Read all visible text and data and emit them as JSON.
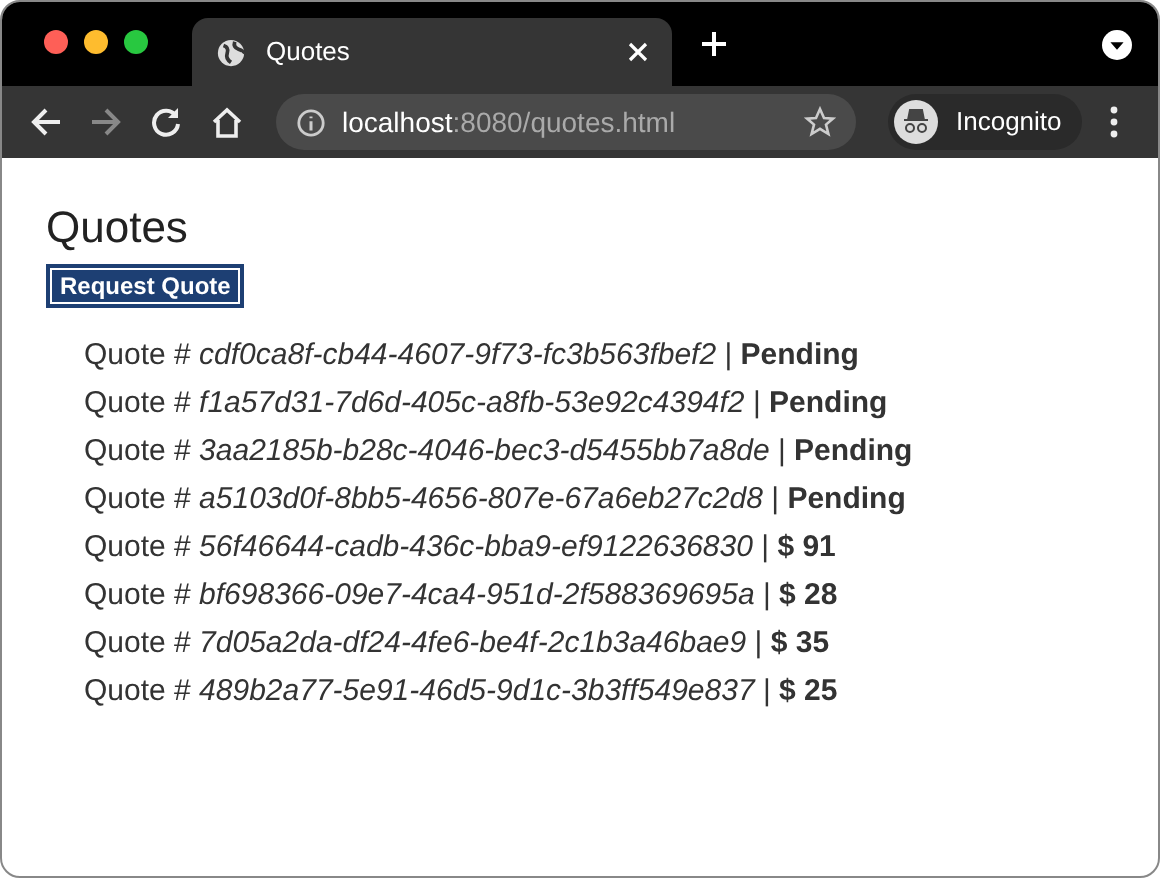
{
  "browser": {
    "tab_title": "Quotes",
    "url_host": "localhost",
    "url_rest": ":8080/quotes.html",
    "profile": "Incognito"
  },
  "page": {
    "heading": "Quotes",
    "button": "Request Quote",
    "quotes": [
      "Quote # *cdf0ca8f-cb44-4607-9f73-fc3b563fbef2* | **Pending**",
      "Quote # *f1a57d31-7d6d-405c-a8fb-53e92c4394f2* | **Pending**",
      "Quote # *3aa2185b-b28c-4046-bec3-d5455bb7a8de* | **Pending**",
      "Quote # *a5103d0f-8bb5-4656-807e-67a6eb27c2d8* | **Pending**",
      "Quote # *56f46644-cadb-436c-bba9-ef9122636830* | **$ 91**",
      "Quote # *bf698366-09e7-4ca4-951d-2f588369695a* | **$ 28**",
      "Quote # *7d05a2da-df24-4fe6-be4f-2c1b3a46bae9* | **$ 35**",
      "Quote # *489b2a77-5e91-46d5-9d1c-3b3ff549e837* | **$ 25**"
    ]
  }
}
